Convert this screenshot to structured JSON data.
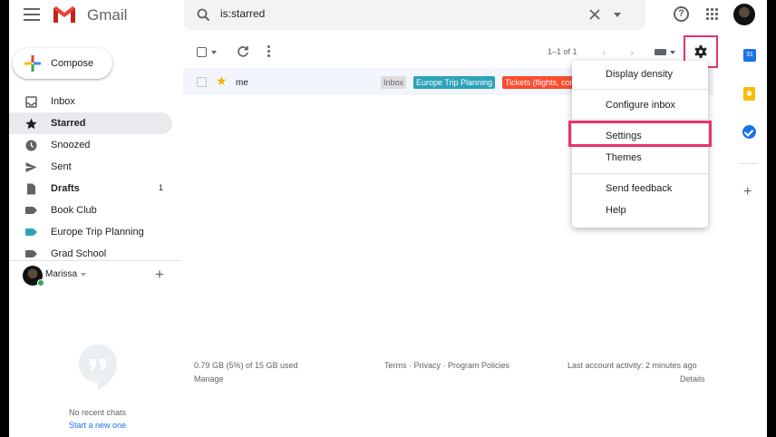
{
  "header": {
    "app_name": "Gmail",
    "search_value": "is:starred",
    "icons": [
      "menu-icon",
      "gmail-logo",
      "search-icon",
      "close-icon",
      "caret-down-icon",
      "help-icon",
      "apps-icon",
      "profile-avatar"
    ]
  },
  "compose": {
    "label": "Compose"
  },
  "nav": {
    "items": [
      {
        "label": "Inbox",
        "icon": "inbox-icon",
        "bold": false
      },
      {
        "label": "Starred",
        "icon": "star-icon",
        "bold": true,
        "active": true
      },
      {
        "label": "Snoozed",
        "icon": "clock-icon",
        "bold": false
      },
      {
        "label": "Sent",
        "icon": "send-icon",
        "bold": false
      },
      {
        "label": "Drafts",
        "icon": "draft-icon",
        "bold": true,
        "count": "1"
      },
      {
        "label": "Book Club",
        "icon": "label-icon",
        "color": "#5f6368"
      },
      {
        "label": "Europe Trip Planning",
        "icon": "label-icon",
        "color": "#2da2bb"
      },
      {
        "label": "Grad School",
        "icon": "label-icon",
        "color": "#5f6368"
      }
    ]
  },
  "chat": {
    "user_name": "Marissa",
    "empty_text": "No recent chats",
    "start_link": "Start a new one"
  },
  "toolbar": {
    "pagination": "1–1 of 1",
    "icons": [
      "checkbox-icon",
      "refresh-icon",
      "more-vert-icon",
      "chevron-left-icon",
      "chevron-right-icon",
      "keyboard-icon",
      "gear-icon"
    ]
  },
  "messages": [
    {
      "sender": "me",
      "starred": true,
      "labels": [
        {
          "text": "Inbox",
          "bg": "#dddddd",
          "fg": "#666666"
        },
        {
          "text": "Europe Trip Planning",
          "bg": "#2da2bb",
          "fg": "#ffffff"
        },
        {
          "text": "Tickets (flights, conc",
          "bg": "#fb4c2f",
          "fg": "#ffffff"
        }
      ]
    }
  ],
  "settings_menu": {
    "items": [
      "Display density",
      "Configure inbox",
      "Settings",
      "Themes",
      "Send feedback",
      "Help"
    ],
    "highlighted": "Settings",
    "highlight_color": "#e8336b"
  },
  "footer": {
    "storage": "0.79 GB (5%) of 15 GB used",
    "manage": "Manage",
    "links": "Terms · Privacy · Program Policies",
    "activity": "Last account activity: 2 minutes ago",
    "details": "Details"
  },
  "right_rail": {
    "calendar_day": "31",
    "icons": [
      "calendar-icon",
      "keep-icon",
      "tasks-icon",
      "add-icon"
    ]
  }
}
